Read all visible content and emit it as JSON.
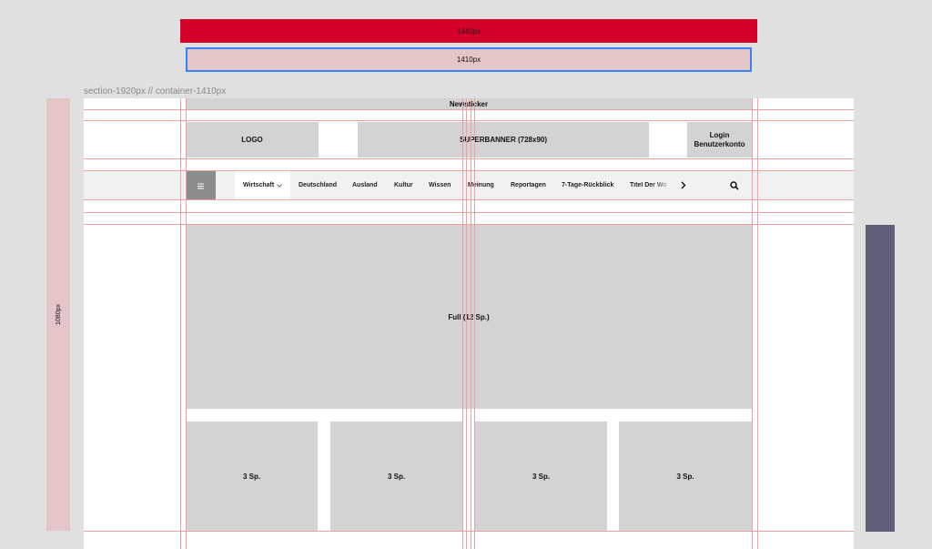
{
  "top_bars": {
    "red_label": "1440px",
    "blue_label": "1410px"
  },
  "section_label": "section-1920px //  container-1410px",
  "left_strip_label": "1080px",
  "header": {
    "newsticker": "Newsticker",
    "logo": "LOGO",
    "superbanner": "SUPERBANNER (728x90)",
    "login_line1": "Login",
    "login_line2": "Benutzerkonto"
  },
  "nav": {
    "menu_icon": "≡",
    "items": [
      {
        "label": "Wirtschaft"
      },
      {
        "label": "Deutschland"
      },
      {
        "label": "Ausland"
      },
      {
        "label": "Kultur"
      },
      {
        "label": "Wissen"
      },
      {
        "label": "Meinung"
      },
      {
        "label": "Reportagen"
      },
      {
        "label": "7-Tage-Rückblick"
      },
      {
        "label": "Titel Der Wo"
      }
    ],
    "dropdown_icon": "chevron-down-icon",
    "next_icon": "chevron-right-icon",
    "search_icon": "search-icon"
  },
  "content": {
    "full_label": "Full (12 Sp.)",
    "columns": [
      {
        "label": "3 Sp."
      },
      {
        "label": "3 Sp."
      },
      {
        "label": "3 Sp."
      },
      {
        "label": "3 Sp."
      }
    ]
  },
  "colors": {
    "accent_red": "#d5002a",
    "pink": "#e4c5c8",
    "selection_blue": "#3b82f6",
    "slate": "#5f5f7a",
    "grey_box": "#d3d3d3"
  }
}
